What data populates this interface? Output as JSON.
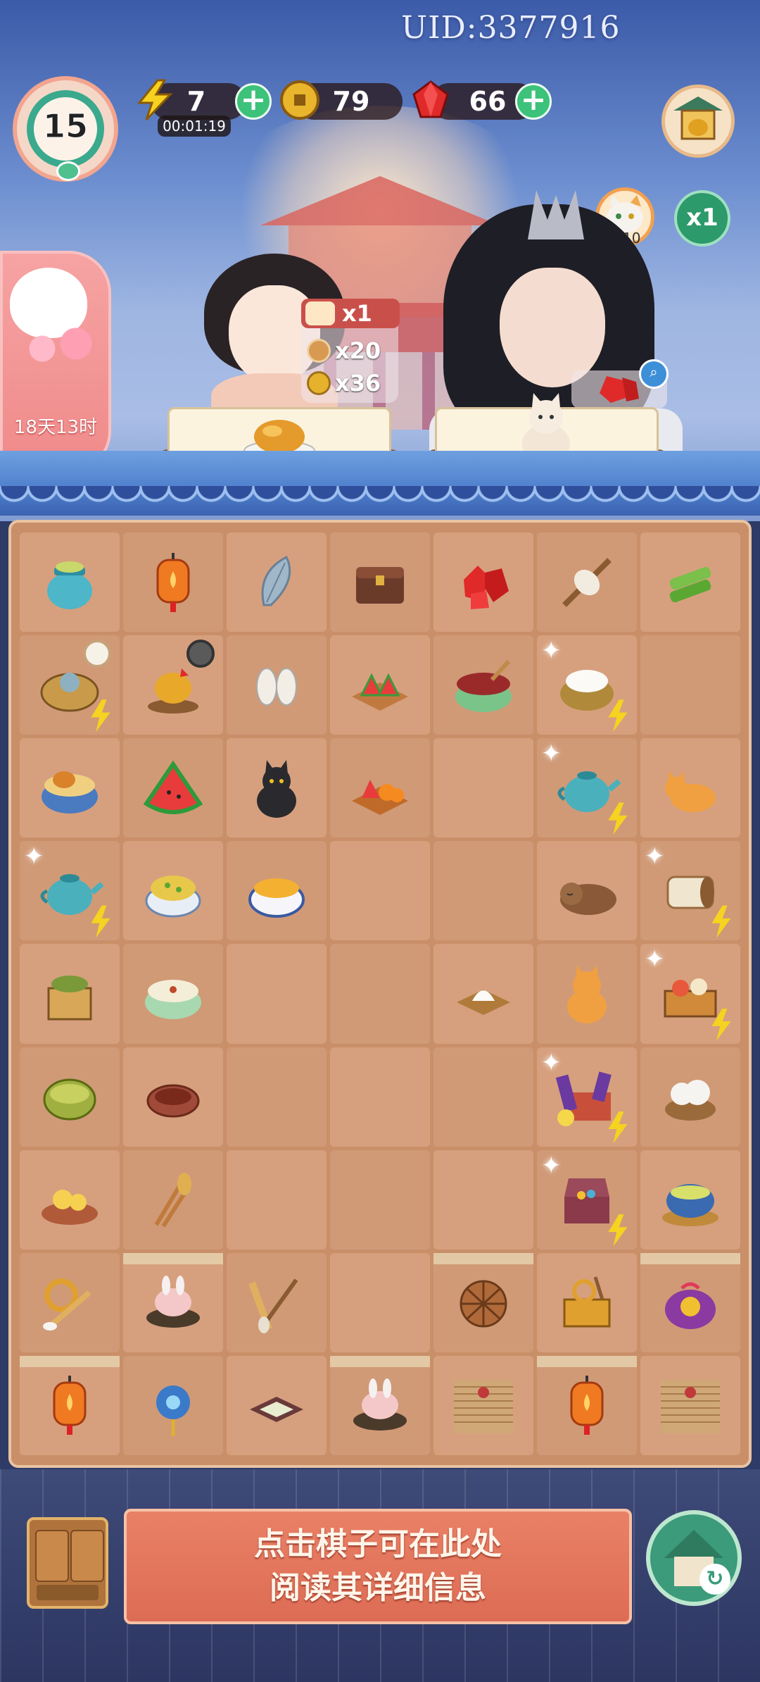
{
  "header": {
    "uid": "UID:3377916",
    "level": "15",
    "energy": {
      "value": "7",
      "timer": "00:01:19",
      "icon": "lightning-icon"
    },
    "coins": {
      "value": "79",
      "icon": "coin-icon"
    },
    "gems": {
      "value": "66",
      "icon": "ruby-icon"
    },
    "cat_capacity": "8/10",
    "multiplier": "x1"
  },
  "event": {
    "countdown": "18天13时",
    "icon": "bunny-icon"
  },
  "orders": [
    {
      "request_count": "x1",
      "rewards": [
        {
          "icon": "mooncake-icon",
          "amount": "x20"
        },
        {
          "icon": "coin-icon",
          "amount": "x36"
        }
      ],
      "dish_icon": "roast-chicken-icon"
    },
    {
      "dish_icon": "white-cat-icon",
      "reward_icon": "ruby-icon"
    }
  ],
  "board": {
    "rows": [
      [
        "tea-jar",
        "lantern",
        "feather",
        "wooden-chest",
        "ruby-pile",
        "spindle",
        "bamboo"
      ],
      [
        "knitting-basket",
        "rooster-nest",
        "silk-cocoons",
        "watermelon-platter",
        "red-bean-soup",
        "flour-bowl",
        "empty"
      ],
      [
        "chicken-rice-bowl",
        "watermelon-slice",
        "black-cat",
        "fruit-platter",
        "empty",
        "teapot",
        "orange-kitten"
      ],
      [
        "teapot",
        "fried-rice-bowl",
        "egg-custard-bowl",
        "empty",
        "empty",
        "sleeping-tabby-cat",
        "scroll-roll"
      ],
      [
        "tea-box",
        "congee-bowl",
        "empty",
        "empty",
        "salt-tray",
        "orange-cat-sitting",
        "fruit-crate"
      ],
      [
        "woven-basket",
        "bird-nest",
        "empty",
        "empty",
        "empty",
        "gift-box",
        "cotton-bowl"
      ],
      [
        "chick-nest",
        "wheat-bundle",
        "empty",
        "empty",
        "empty",
        "treasure-chest",
        "tea-bowl"
      ],
      [
        "painting-tools",
        "rabbit-dumpling-plate",
        "brush-ruler",
        "empty",
        "rattan-ball",
        "toolbox",
        "purple-sachet"
      ],
      [
        "lantern",
        "blue-hairpin",
        "ink-tray",
        "rabbit-dumpling-plate",
        "bamboo-blind",
        "lantern",
        "bamboo-blind"
      ]
    ]
  },
  "footer": {
    "hint_line1": "点击棋子可在此处",
    "hint_line2": "阅读其详细信息",
    "left_icon": "cabinet-icon",
    "right_icon": "home-pavilion-icon"
  },
  "colors": {
    "accent_green": "#3cc27a",
    "hint_box": "#dd6c55",
    "board": "#d6a07e"
  }
}
